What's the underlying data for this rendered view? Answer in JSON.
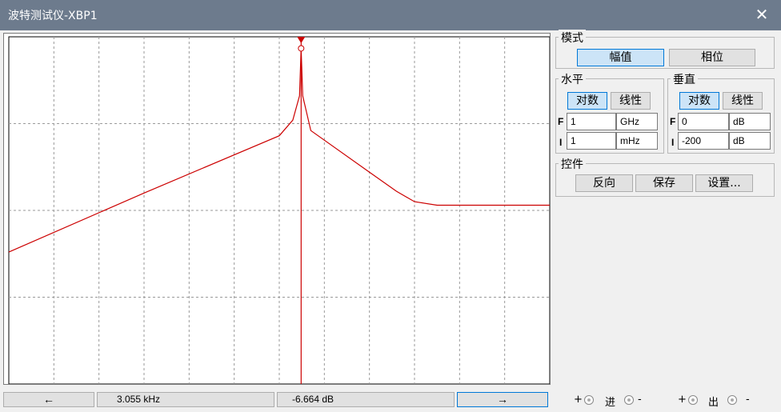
{
  "window": {
    "title": "波特测试仪-XBP1",
    "close_icon": "close-icon"
  },
  "mode": {
    "label": "模式",
    "magnitude": "幅值",
    "phase": "相位",
    "selected": "幅值"
  },
  "horizontal": {
    "label": "水平",
    "log": "对数",
    "lin": "线性",
    "selected": "对数",
    "F_label": "F",
    "F_value": "1",
    "F_unit": "GHz",
    "I_label": "I",
    "I_value": "1",
    "I_unit": "mHz"
  },
  "vertical": {
    "label": "垂直",
    "log": "对数",
    "lin": "线性",
    "selected": "对数",
    "F_label": "F",
    "F_value": "0",
    "F_unit": "dB",
    "I_label": "I",
    "I_value": "-200",
    "I_unit": "dB"
  },
  "controls": {
    "label": "控件",
    "reverse": "反向",
    "save": "保存",
    "settings": "设置..."
  },
  "readout": {
    "left_arrow": "←",
    "frequency": "3.055 kHz",
    "gain": "-6.664 dB",
    "right_arrow": "→"
  },
  "terminals": {
    "in_plus": "+",
    "in_label": "进",
    "in_minus": "-",
    "out_plus": "+",
    "out_label": "出",
    "out_minus": "-"
  },
  "chart_data": {
    "type": "line",
    "title": "",
    "xlabel": "",
    "ylabel": "",
    "x_scale": "log",
    "xlim_hz": [
      0.001,
      1000000000
    ],
    "ylim_db": [
      -200,
      0
    ],
    "grid": true,
    "series": [
      {
        "color": "#cc0000",
        "points_log10hz_db": [
          [
            -3.0,
            -124
          ],
          [
            0.0,
            -90
          ],
          [
            3.0,
            -57
          ],
          [
            3.3,
            -48
          ],
          [
            3.45,
            -34
          ],
          [
            3.485,
            -6.664
          ],
          [
            3.52,
            -34
          ],
          [
            3.7,
            -54
          ],
          [
            5.0,
            -78
          ],
          [
            5.6,
            -89
          ],
          [
            6.0,
            -95
          ],
          [
            6.5,
            -97
          ],
          [
            9.0,
            -97
          ]
        ]
      }
    ],
    "cursor": {
      "frequency": "3.055 kHz",
      "gain_db": -6.664
    }
  }
}
